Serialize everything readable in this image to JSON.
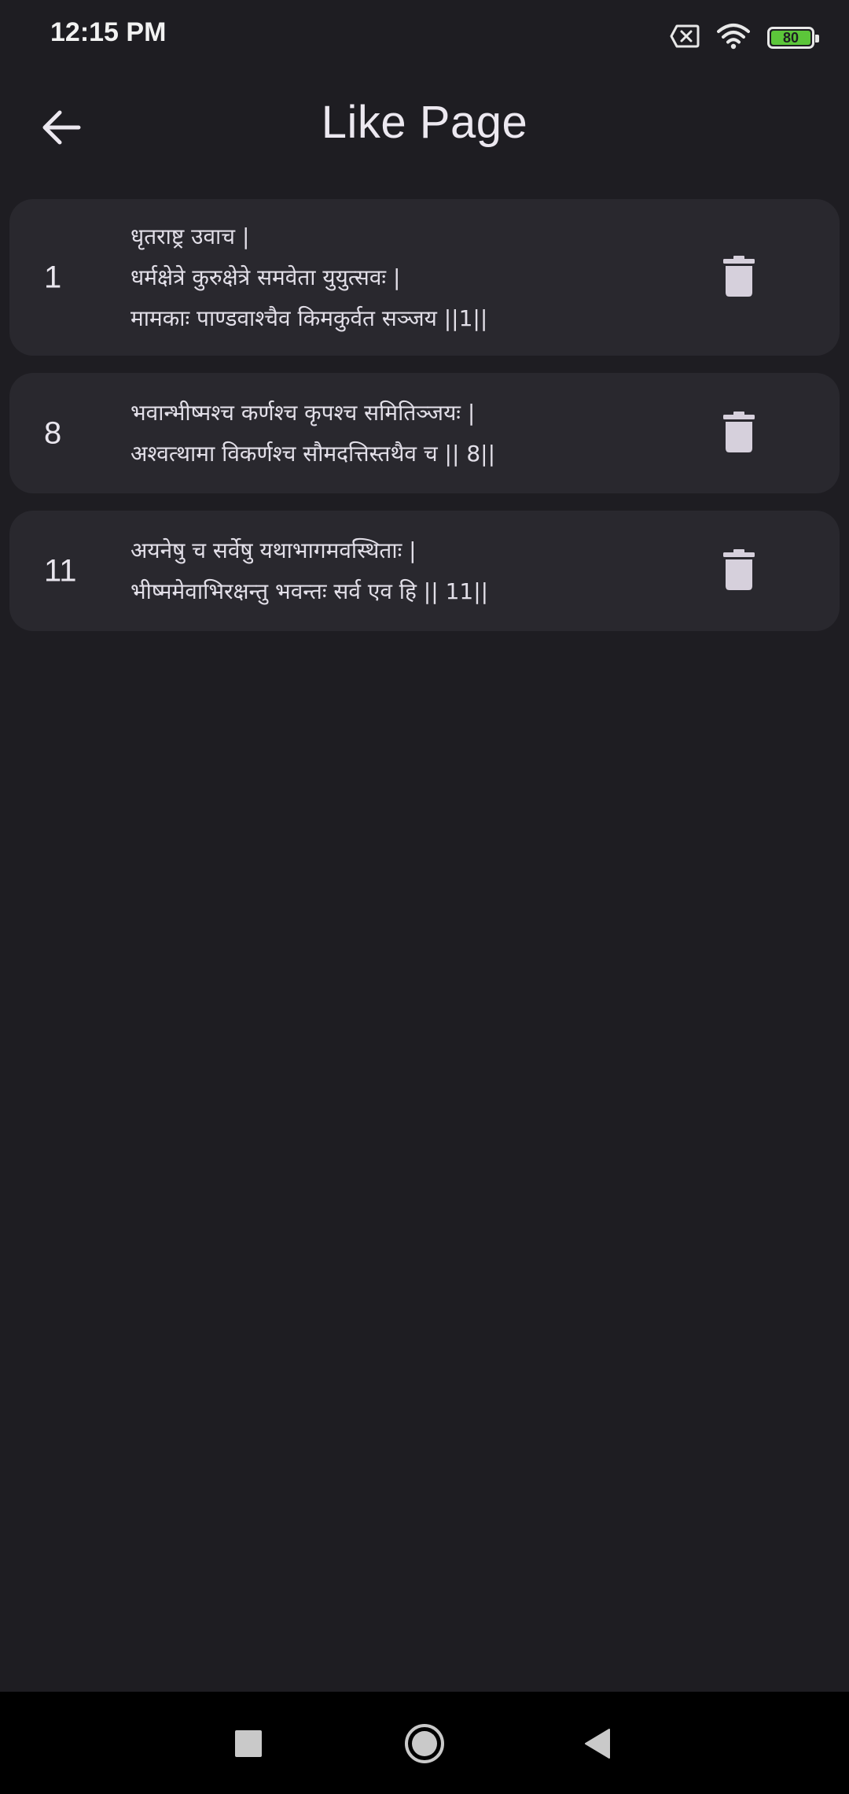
{
  "status_bar": {
    "time": "12:15 PM",
    "battery_level": "80",
    "icons": [
      "sim-x-icon",
      "wifi-icon",
      "battery-icon"
    ],
    "battery_color": "#5cc63a"
  },
  "app_bar": {
    "title": "Like Page",
    "back_icon": "arrow-left-icon"
  },
  "liked_verses": [
    {
      "number": "1",
      "lines": [
        "धृतराष्ट्र उवाच |",
        "धर्मक्षेत्रे कुरुक्षेत्रे समवेता युयुत्सवः |",
        "मामकाः पाण्डवाश्चैव किमकुर्वत सञ्जय ||1||"
      ],
      "action_icon": "trash-icon"
    },
    {
      "number": "8",
      "lines": [
        "भवान्भीष्मश्च कर्णश्च कृपश्च समितिञ्जयः |",
        "अश्वत्थामा विकर्णश्च सौमदत्तिस्तथैव च || 8||"
      ],
      "action_icon": "trash-icon"
    },
    {
      "number": "11",
      "lines": [
        "अयनेषु च सर्वेषु यथाभागमवस्थिताः |",
        "भीष्ममेवाभिरक्षन्तु भवन्तः सर्व एव हि || 11||"
      ],
      "action_icon": "trash-icon"
    }
  ],
  "navigation_bar": {
    "icons": [
      "recents-square-icon",
      "home-circle-icon",
      "back-triangle-icon"
    ]
  },
  "colors": {
    "background": "#1e1d22",
    "card": "#29282e",
    "text": "#e9e6ee",
    "icon": "#d6d0dc"
  }
}
